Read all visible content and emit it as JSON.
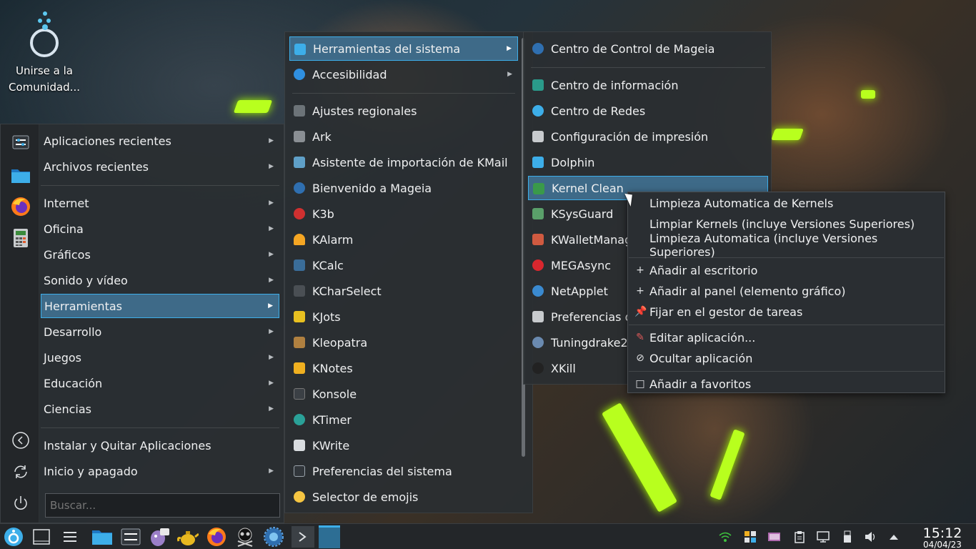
{
  "desktop": {
    "icon_label_line1": "Unirse a la",
    "icon_label_line2": "Comunidad..."
  },
  "main_menu": {
    "items": [
      {
        "label": "Aplicaciones recientes"
      },
      {
        "label": "Archivos recientes"
      },
      {
        "label": "Internet"
      },
      {
        "label": "Oficina"
      },
      {
        "label": "Gráficos"
      },
      {
        "label": "Sonido y vídeo"
      },
      {
        "label": "Herramientas"
      },
      {
        "label": "Desarrollo"
      },
      {
        "label": "Juegos"
      },
      {
        "label": "Educación"
      },
      {
        "label": "Ciencias"
      },
      {
        "label": "Instalar y Quitar Aplicaciones"
      },
      {
        "label": "Inicio y apagado"
      }
    ],
    "search_placeholder": "Buscar..."
  },
  "tools_menu": {
    "items": [
      {
        "label": "Herramientas del sistema",
        "icon": "system-tools-icon"
      },
      {
        "label": "Accesibilidad",
        "icon": "accessibility-icon"
      },
      {
        "label": "Ajustes regionales",
        "icon": "regional-icon"
      },
      {
        "label": "Ark",
        "icon": "ark-icon"
      },
      {
        "label": "Asistente de importación de KMail",
        "icon": "kmail-import-icon"
      },
      {
        "label": "Bienvenido a Mageia",
        "icon": "mageia-welcome-icon"
      },
      {
        "label": "K3b",
        "icon": "k3b-icon"
      },
      {
        "label": "KAlarm",
        "icon": "kalarm-icon"
      },
      {
        "label": "KCalc",
        "icon": "kcalc-icon"
      },
      {
        "label": "KCharSelect",
        "icon": "kcharselect-icon"
      },
      {
        "label": "KJots",
        "icon": "kjots-icon"
      },
      {
        "label": "Kleopatra",
        "icon": "kleopatra-icon"
      },
      {
        "label": "KNotes",
        "icon": "knotes-icon"
      },
      {
        "label": "Konsole",
        "icon": "konsole-icon"
      },
      {
        "label": "KTimer",
        "icon": "ktimer-icon"
      },
      {
        "label": "KWrite",
        "icon": "kwrite-icon"
      },
      {
        "label": "Preferencias del sistema",
        "icon": "system-settings-icon"
      },
      {
        "label": "Selector de emojis",
        "icon": "emoji-icon"
      }
    ]
  },
  "system_tools_menu": {
    "items": [
      {
        "label": "Centro de Control de Mageia",
        "icon": "mageia-control-icon"
      },
      {
        "label": "Centro de información",
        "icon": "info-center-icon"
      },
      {
        "label": "Centro de Redes",
        "icon": "network-center-icon"
      },
      {
        "label": "Configuración de impresión",
        "icon": "printer-icon"
      },
      {
        "label": "Dolphin",
        "icon": "dolphin-icon"
      },
      {
        "label": "Kernel Clean",
        "icon": "kernel-clean-icon"
      },
      {
        "label": "KSysGuard",
        "icon": "ksysguard-icon"
      },
      {
        "label": "KWalletManager",
        "icon": "kwallet-icon"
      },
      {
        "label": "MEGAsync",
        "icon": "megasync-icon"
      },
      {
        "label": "NetApplet",
        "icon": "netapplet-icon"
      },
      {
        "label": "Preferencias del sistema",
        "icon": "preferences-icon"
      },
      {
        "label": "Tuningdrake2",
        "icon": "tuningdrake-icon"
      },
      {
        "label": "XKill",
        "icon": "xkill-icon"
      }
    ]
  },
  "context_menu": {
    "items": [
      {
        "label": "Limpieza Automatica de Kernels"
      },
      {
        "label": "Limpiar Kernels (incluye Versiones Superiores)"
      },
      {
        "label": "Limpieza Automatica (incluye Versiones Superiores)"
      },
      {
        "label": "Añadir al escritorio"
      },
      {
        "label": "Añadir al panel (elemento gráfico)"
      },
      {
        "label": "Fijar en el gestor de tareas"
      },
      {
        "label": "Editar aplicación..."
      },
      {
        "label": "Ocultar aplicación"
      },
      {
        "label": "Añadir a favoritos"
      }
    ]
  },
  "taskbar": {
    "time": "15:12",
    "date": "04/04/23"
  },
  "colors": {
    "highlight": "#3daee9",
    "panel": "#2a2e32"
  }
}
